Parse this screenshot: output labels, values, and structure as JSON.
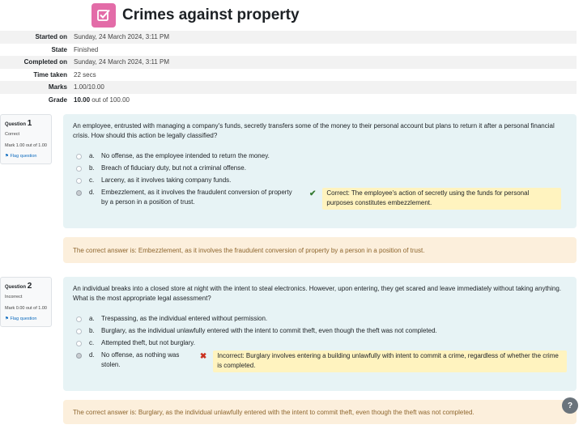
{
  "page": {
    "title": "Crimes against property",
    "icon": "quiz-icon",
    "accent": "#e36ca8"
  },
  "summary": [
    {
      "label": "Started on",
      "value": "Sunday, 24 March 2024, 3:11 PM"
    },
    {
      "label": "State",
      "value": "Finished"
    },
    {
      "label": "Completed on",
      "value": "Sunday, 24 March 2024, 3:11 PM"
    },
    {
      "label": "Time taken",
      "value": "22 secs"
    },
    {
      "label": "Marks",
      "value": "1.00/10.00"
    },
    {
      "label": "Grade",
      "value_bold": "10.00",
      "value_rest": " out of 100.00"
    }
  ],
  "questions": [
    {
      "prefix": "Question",
      "number": "1",
      "status": "Correct",
      "mark": "Mark 1.00 out of 1.00",
      "flag_label": "Flag question",
      "text": "An employee, entrusted with managing a company's funds, secretly transfers some of the money to their personal account but plans to return it after a personal financial crisis. How should this action be legally classified?",
      "options": [
        {
          "letter": "a.",
          "text": "No offense, as the employee intended to return the money."
        },
        {
          "letter": "b.",
          "text": "Breach of fiduciary duty, but not a criminal offense."
        },
        {
          "letter": "c.",
          "text": "Larceny, as it involves taking company funds."
        },
        {
          "letter": "d.",
          "text": "Embezzlement, as it involves the fraudulent conversion of property by a person in a position of trust.",
          "selected": true,
          "mark": "✔",
          "feedback": "Correct: The employee's action of secretly using the funds for personal purposes constitutes embezzlement."
        }
      ],
      "right_answer": "The correct answer is: Embezzlement, as it involves the fraudulent conversion of property by a person in a position of trust."
    },
    {
      "prefix": "Question",
      "number": "2",
      "status": "Incorrect",
      "mark": "Mark 0.00 out of 1.00",
      "flag_label": "Flag question",
      "text": "An individual breaks into a closed store at night with the intent to steal electronics. However, upon entering, they get scared and leave immediately without taking anything. What is the most appropriate legal assessment?",
      "options": [
        {
          "letter": "a.",
          "text": "Trespassing, as the individual entered without permission."
        },
        {
          "letter": "b.",
          "text": "Burglary, as the individual unlawfully entered with the intent to commit theft, even though the theft was not completed."
        },
        {
          "letter": "c.",
          "text": "Attempted theft, but not burglary."
        },
        {
          "letter": "d.",
          "text": "No offense, as nothing was stolen.",
          "selected": true,
          "mark": "✖",
          "feedback": "Incorrect: Burglary involves entering a building unlawfully with intent to commit a crime, regardless of whether the crime is completed."
        }
      ],
      "right_answer": "The correct answer is: Burglary, as the individual unlawfully entered with the intent to commit theft, even though the theft was not completed."
    }
  ],
  "help": {
    "label": "?"
  }
}
